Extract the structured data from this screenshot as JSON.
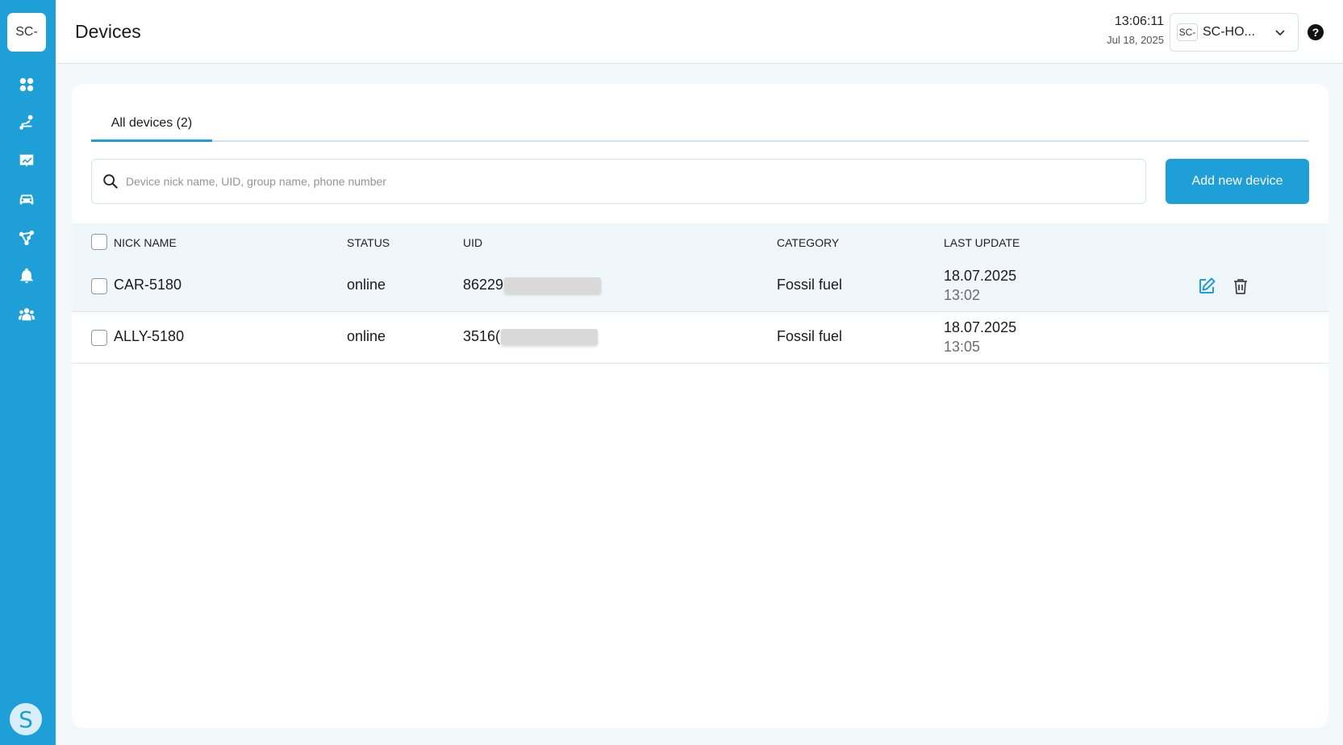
{
  "app": {
    "logo_text": "SC-",
    "page_title": "Devices",
    "avatar_letter": "S"
  },
  "sidebar": {
    "items": [
      {
        "icon": "dashboard-icon"
      },
      {
        "icon": "routes-icon"
      },
      {
        "icon": "reports-icon"
      },
      {
        "icon": "car-icon"
      },
      {
        "icon": "geofence-icon"
      },
      {
        "icon": "bell-icon"
      },
      {
        "icon": "users-icon"
      }
    ]
  },
  "header": {
    "time": "13:06:11",
    "date": "Jul 18, 2025",
    "account_badge": "SC-",
    "account_name": "SC-HO...",
    "help": "?"
  },
  "tabs": [
    {
      "label": "All devices (2)",
      "active": true
    }
  ],
  "search": {
    "placeholder": "Device nick name, UID, group name, phone number",
    "value": ""
  },
  "actions": {
    "add_label": "Add new device"
  },
  "table": {
    "columns": [
      "NICK NAME",
      "STATUS",
      "UID",
      "CATEGORY",
      "LAST UPDATE"
    ],
    "rows": [
      {
        "nick": "CAR-5180",
        "status": "online",
        "uid_visible": "86229",
        "category": "Fossil fuel",
        "date": "18.07.2025",
        "time": "13:02"
      },
      {
        "nick": "ALLY-5180",
        "status": "online",
        "uid_visible": "3516(",
        "category": "Fossil fuel",
        "date": "18.07.2025",
        "time": "13:05"
      }
    ]
  },
  "colors": {
    "accent": "#1e9fd8",
    "sidebar": "#1e9fd8",
    "row_highlight": "#f0f7fb"
  }
}
